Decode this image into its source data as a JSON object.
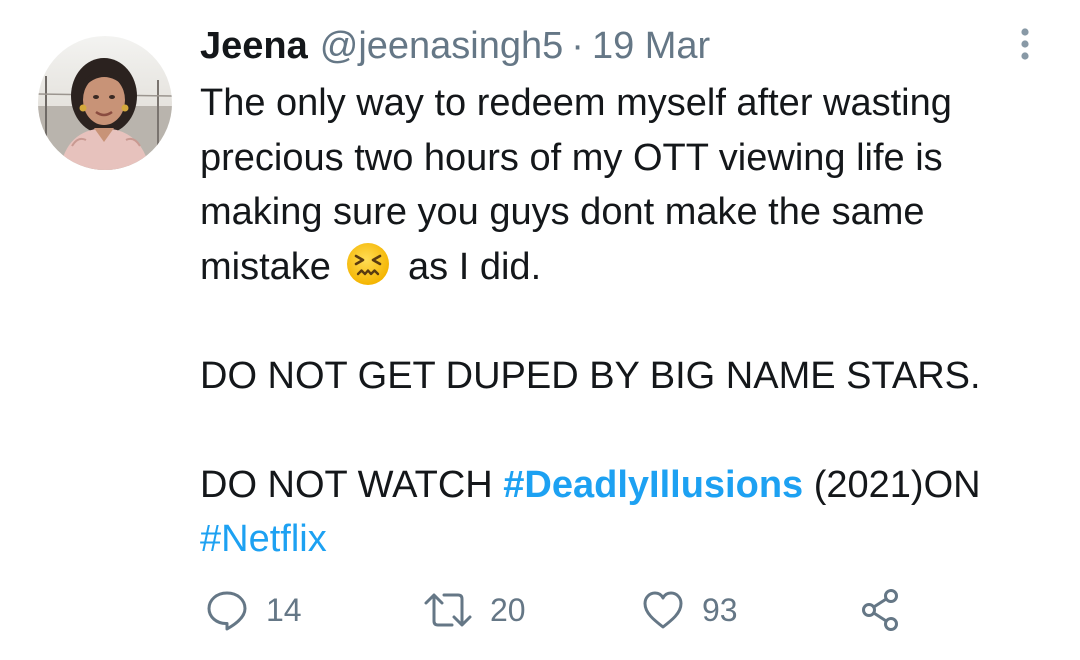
{
  "tweet": {
    "author": {
      "display_name": "Jeena",
      "handle": "@jeenasingh5",
      "separator": "·",
      "date": "19 Mar"
    },
    "body": {
      "line1": "The only way to redeem myself after wasting",
      "line2": "precious two hours of my OTT viewing life is",
      "line3": "making sure you guys dont make the same",
      "line4_before_emoji": "mistake",
      "line4_after_emoji": "as I did.",
      "emoji_name": "confounded-face-emoji",
      "line6": "DO NOT GET DUPED BY BIG NAME STARS.",
      "line8_before": "DO NOT WATCH ",
      "hashtag1": "#DeadlyIllusions",
      "line8_after": " (2021)ON",
      "hashtag2": "#Netflix"
    },
    "actions": {
      "reply_count": "14",
      "retweet_count": "20",
      "like_count": "93"
    },
    "icons": {
      "reply": "reply-icon",
      "retweet": "retweet-icon",
      "like": "heart-icon",
      "share": "share-icon",
      "more": "more-vertical-icon"
    },
    "colors": {
      "text": "#14171a",
      "secondary": "#657786",
      "link": "#1da1f2"
    }
  }
}
